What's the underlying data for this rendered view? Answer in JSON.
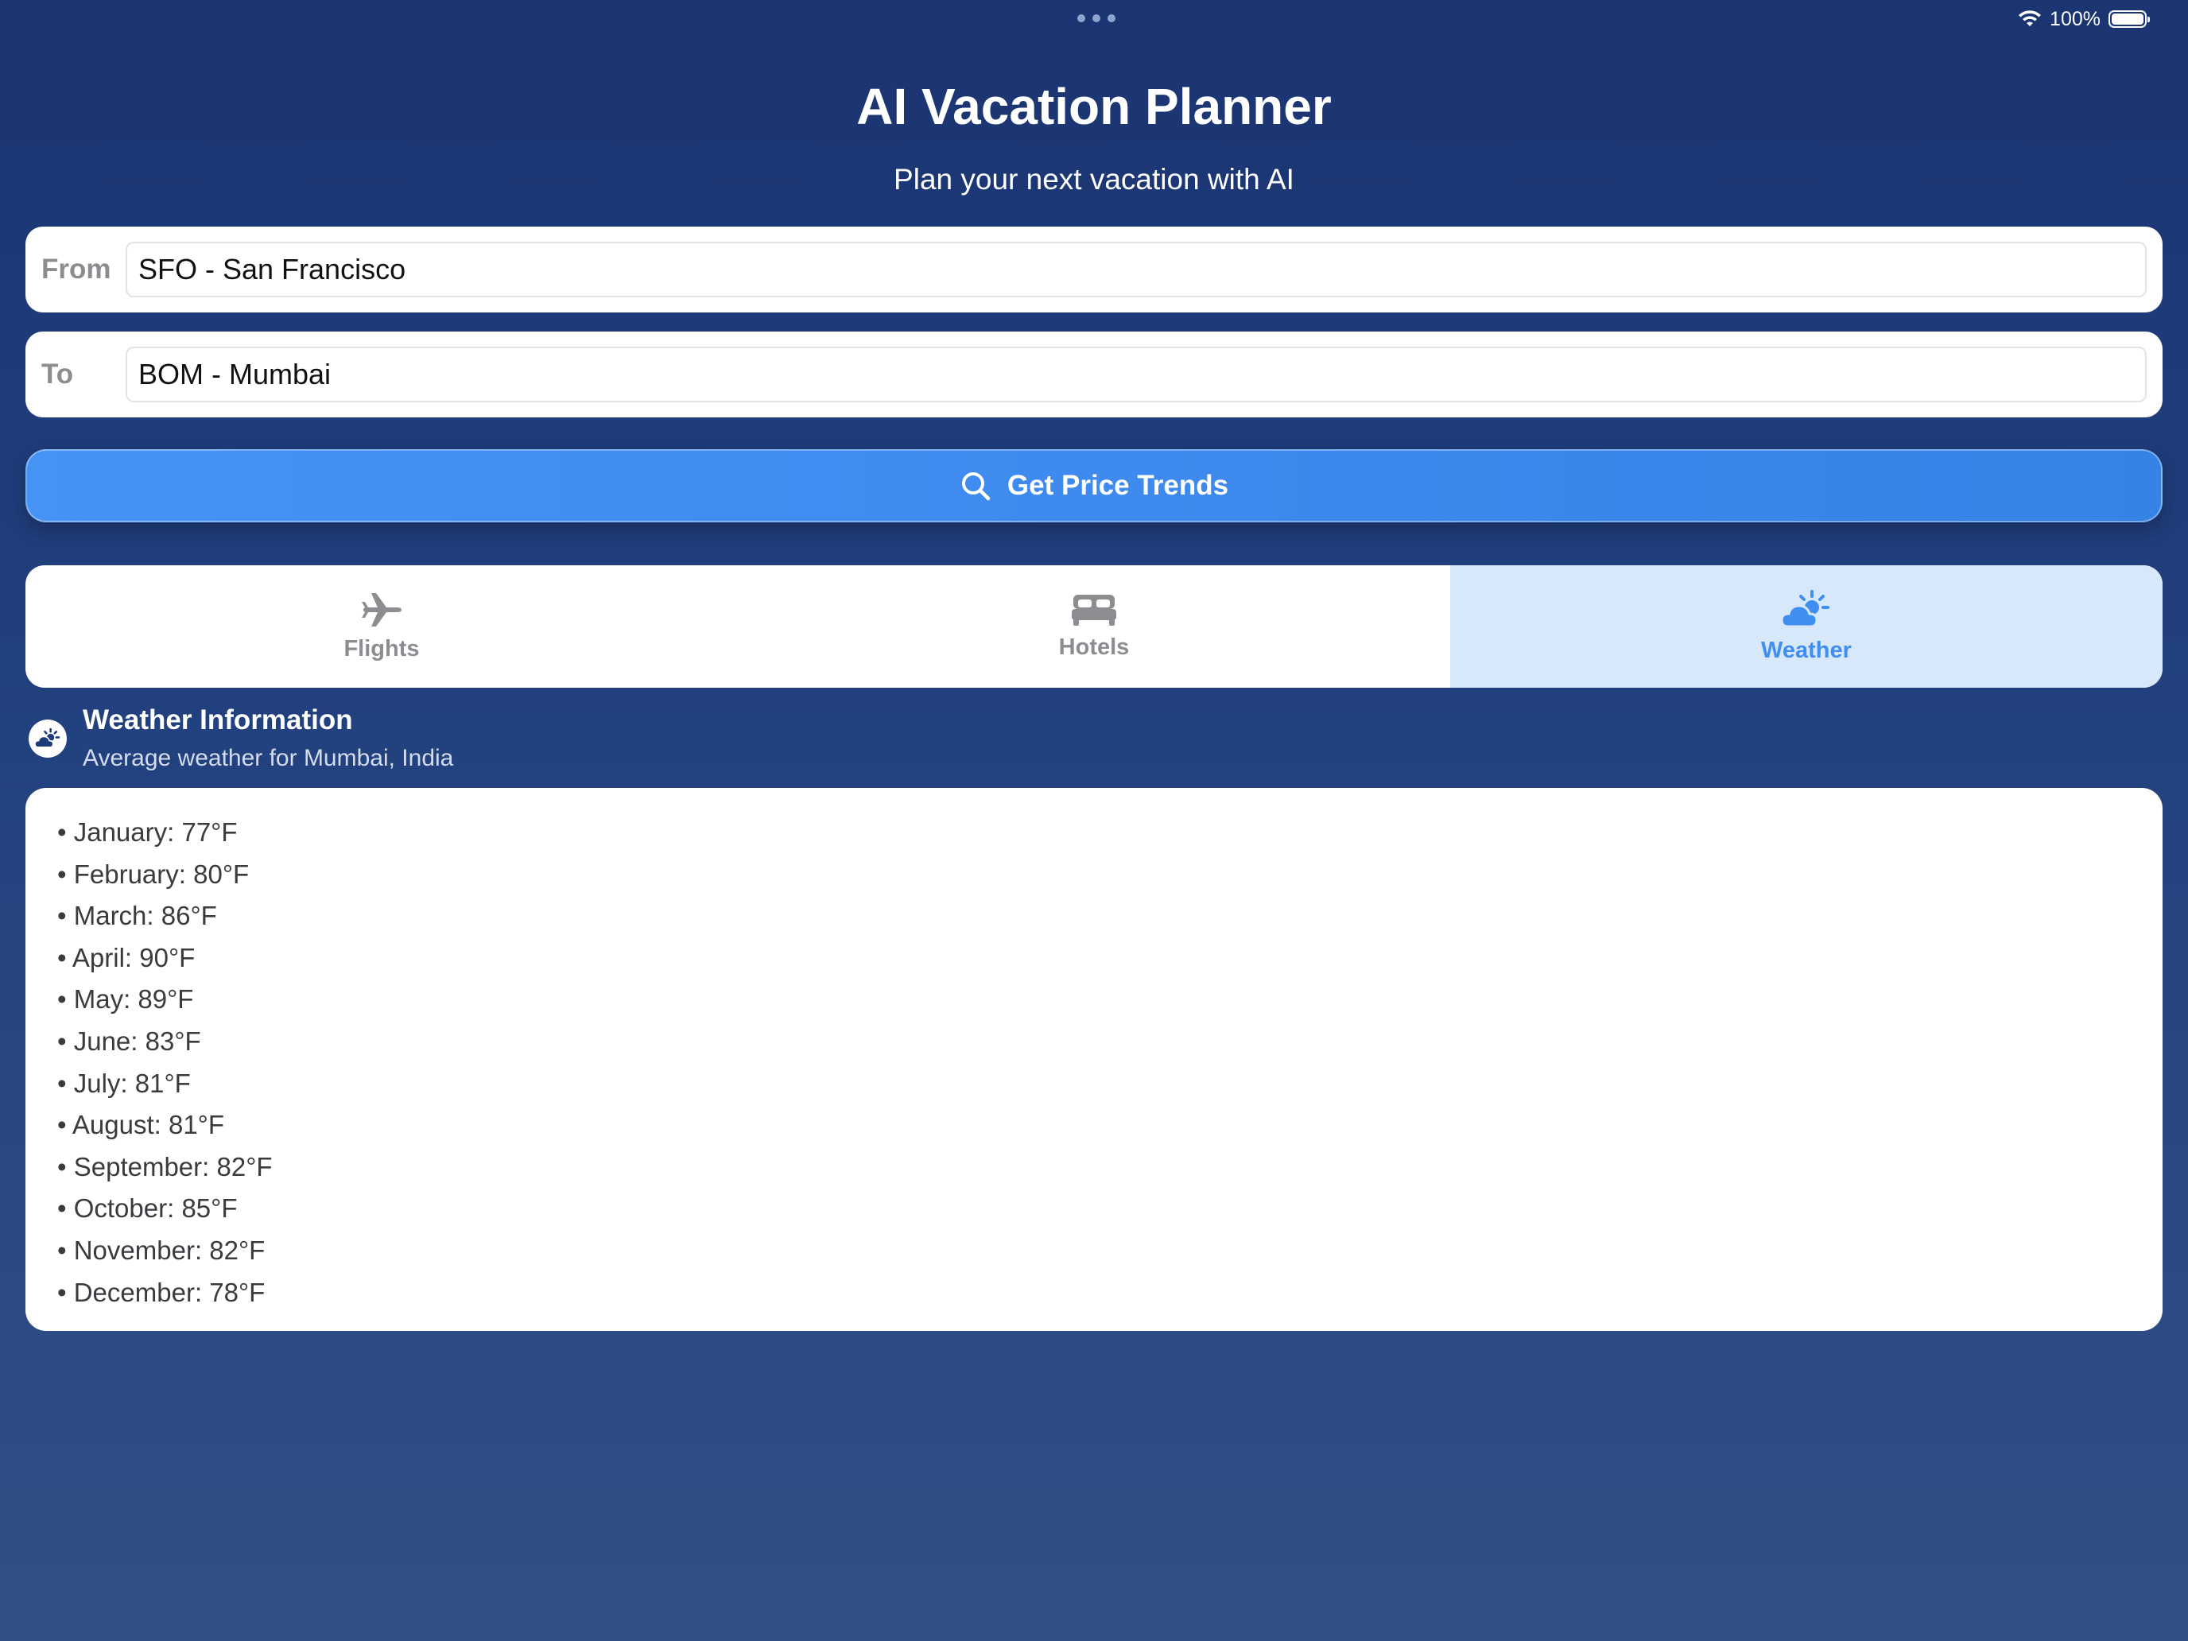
{
  "status_bar": {
    "battery_text": "100%",
    "wifi_icon": "wifi-icon",
    "battery_icon": "battery-icon"
  },
  "header": {
    "title": "AI Vacation Planner",
    "subtitle": "Plan your next vacation with AI"
  },
  "form": {
    "from_label": "From",
    "from_value": "SFO - San Francisco",
    "to_label": "To",
    "to_value": "BOM - Mumbai",
    "submit_label": "Get Price Trends",
    "submit_icon": "search-icon"
  },
  "tabs": [
    {
      "label": "Flights",
      "icon": "airplane-icon",
      "active": false
    },
    {
      "label": "Hotels",
      "icon": "bed-icon",
      "active": false
    },
    {
      "label": "Weather",
      "icon": "partly-cloudy-icon",
      "active": true
    }
  ],
  "weather": {
    "title": "Weather Information",
    "subtitle": "Average weather for Mumbai, India",
    "items": [
      "• January: 77°F",
      "• February: 80°F",
      "• March: 86°F",
      "• April: 90°F",
      "• May: 89°F",
      "• June: 83°F",
      "• July: 81°F",
      "• August: 81°F",
      "• September: 82°F",
      "• October: 85°F",
      "• November: 82°F",
      "• December: 78°F"
    ]
  },
  "colors": {
    "background_top": "#1b3472",
    "background_bottom": "#324f85",
    "accent": "#3f8ef0",
    "active_tab_bg": "#d8e8fb",
    "inactive_text": "#8c8c91"
  }
}
